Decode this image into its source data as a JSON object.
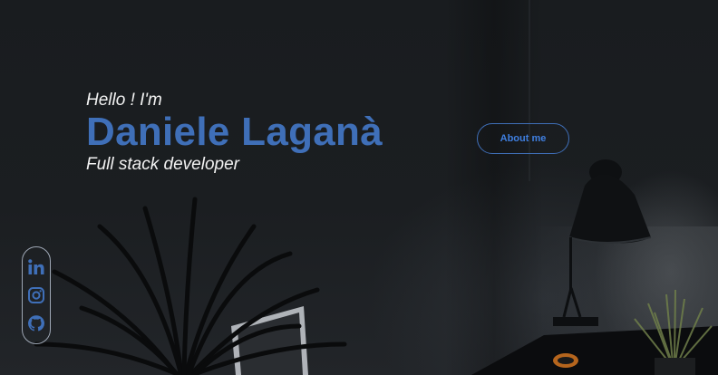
{
  "hero": {
    "greeting": "Hello ! I'm",
    "name": "Daniele Laganà",
    "role": "Full stack developer"
  },
  "buttons": {
    "about_label": "About me"
  },
  "social": [
    {
      "icon": "linkedin-icon"
    },
    {
      "icon": "instagram-icon"
    },
    {
      "icon": "github-icon"
    }
  ],
  "colors": {
    "accent": "#3f6fb8",
    "background": "#15181b",
    "text": "#f2f2f2"
  }
}
